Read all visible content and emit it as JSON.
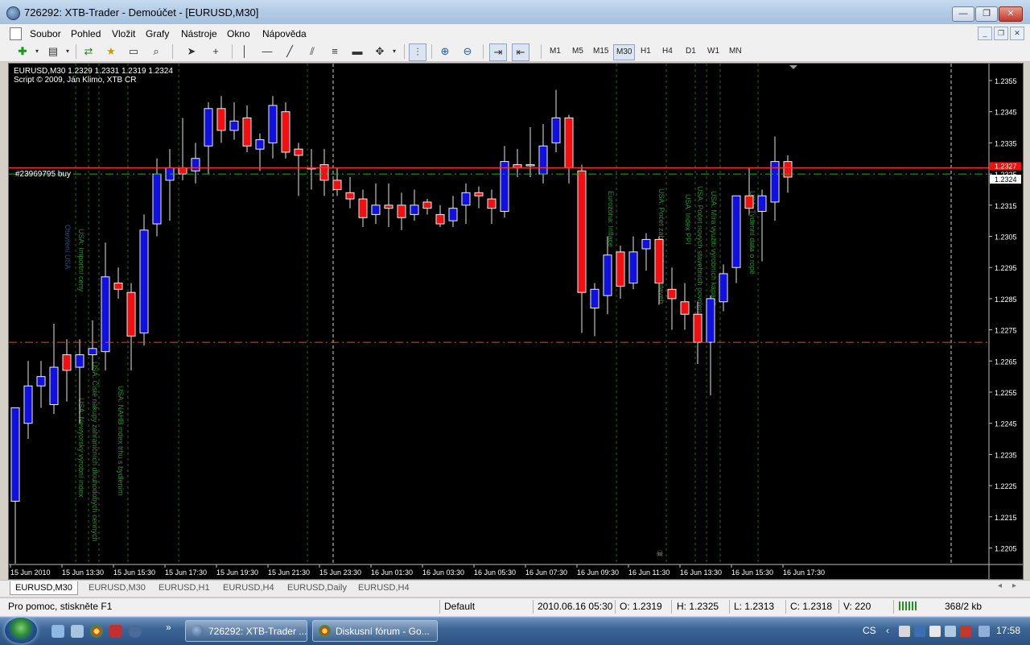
{
  "window": {
    "title": "726292: XTB-Trader - Demoúčet - [EURUSD,M30]",
    "buttons": {
      "minimize": "—",
      "maximize": "❐",
      "close": "✕"
    }
  },
  "menu": [
    "Soubor",
    "Pohled",
    "Vložit",
    "Grafy",
    "Nástroje",
    "Okno",
    "Nápověda"
  ],
  "toolbar": {
    "timeframes": [
      "M1",
      "M5",
      "M15",
      "M30",
      "H1",
      "H4",
      "D1",
      "W1",
      "MN"
    ],
    "active_timeframe": "M30"
  },
  "chart": {
    "header_line1": "EURUSD,M30  1.2329 1.2331 1.2319 1.2324",
    "header_line2": "Script © 2009, Ján Klimo, XTB CR",
    "order_label": "#23969795 buy",
    "current_price_tag": "1.2324",
    "order_price_tag": "1.2327",
    "price_axis": [
      "1.2355",
      "1.2345",
      "1.2335",
      "1.2325",
      "1.2315",
      "1.2305",
      "1.2295",
      "1.2285",
      "1.2275",
      "1.2265",
      "1.2255",
      "1.2245",
      "1.2235",
      "1.2225",
      "1.2215",
      "1.2205"
    ],
    "time_axis": [
      "15 Jun 2010",
      "15 Jun 13:30",
      "15 Jun 15:30",
      "15 Jun 17:30",
      "15 Jun 19:30",
      "15 Jun 21:30",
      "15 Jun 23:30",
      "16 Jun 01:30",
      "16 Jun 03:30",
      "16 Jun 05:30",
      "16 Jun 07:30",
      "16 Jun 09:30",
      "16 Jun 11:30",
      "16 Jun 13:30",
      "16 Jun 15:30",
      "16 Jun 17:30"
    ],
    "news_labels": [
      "Otevření USA",
      "USA: Importní ceny",
      "USA: Čisté nákupy zahraničních dlouhodobých cenných",
      "USA: Newyorský výrobní index",
      "USA: NAHB index trhu s bydlením",
      "Eurozóna: Inflace",
      "USA: Počet zahájených novostaveb",
      "USA: Index PPI",
      "USA: Počet nových stavebních povolení",
      "USA: Míra využití výrobních kapacit",
      "USA: Týdenní data o ropě"
    ],
    "colors": {
      "bullish": "#1010e0",
      "bearish": "#ee1111",
      "background": "#000000",
      "axis_text": "#ffffff",
      "news_text": "#2e8b2e",
      "price_line": "#ff3030",
      "bid_line": "#22aa22"
    }
  },
  "tabs": [
    "EURUSD,M30",
    "EURUSD,M30",
    "EURUSD,H1",
    "EURUSD,H4",
    "EURUSD,Daily",
    "EURUSD,H4"
  ],
  "status": {
    "help": "Pro pomoc, stiskněte F1",
    "profile": "Default",
    "datetime": "2010.06.16 05:30",
    "open": "O: 1.2319",
    "high": "H: 1.2325",
    "low": "L: 1.2313",
    "close": "C: 1.2318",
    "volume": "V: 220",
    "traffic": "368/2 kb"
  },
  "taskbar": {
    "tasks": [
      "726292: XTB-Trader ...",
      "Diskusní fórum - Go..."
    ],
    "language": "CS",
    "clock": "17:58"
  }
}
